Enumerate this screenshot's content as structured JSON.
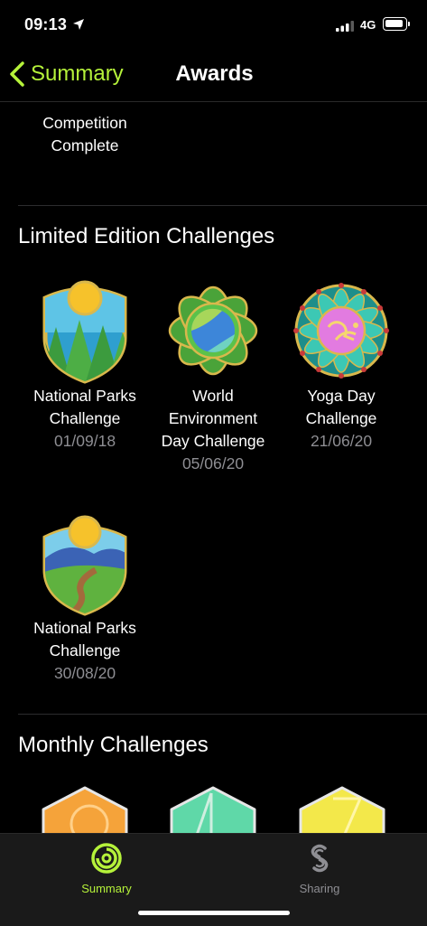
{
  "status": {
    "time": "09:13",
    "network": "4G"
  },
  "nav": {
    "back_label": "Summary",
    "title": "Awards"
  },
  "top_award": {
    "name_line1": "Competition",
    "name_line2": "Complete"
  },
  "limited": {
    "title": "Limited Edition Challenges",
    "awards": [
      {
        "line1": "National Parks",
        "line2": "Challenge",
        "line3": "",
        "date": "01/09/18"
      },
      {
        "line1": "World",
        "line2": "Environment",
        "line3": "Day Challenge",
        "date": "05/06/20"
      },
      {
        "line1": "Yoga Day",
        "line2": "Challenge",
        "line3": "",
        "date": "21/06/20"
      },
      {
        "line1": "National Parks",
        "line2": "Challenge",
        "line3": "",
        "date": "30/08/20"
      }
    ]
  },
  "monthly": {
    "title": "Monthly Challenges"
  },
  "tabs": [
    {
      "label": "Summary",
      "icon": "activity-rings-icon",
      "active": true
    },
    {
      "label": "Sharing",
      "icon": "sharing-icon",
      "active": false
    }
  ],
  "colors": {
    "accent": "#b5f23a",
    "inactive": "#8e8e93",
    "background": "#000000"
  }
}
